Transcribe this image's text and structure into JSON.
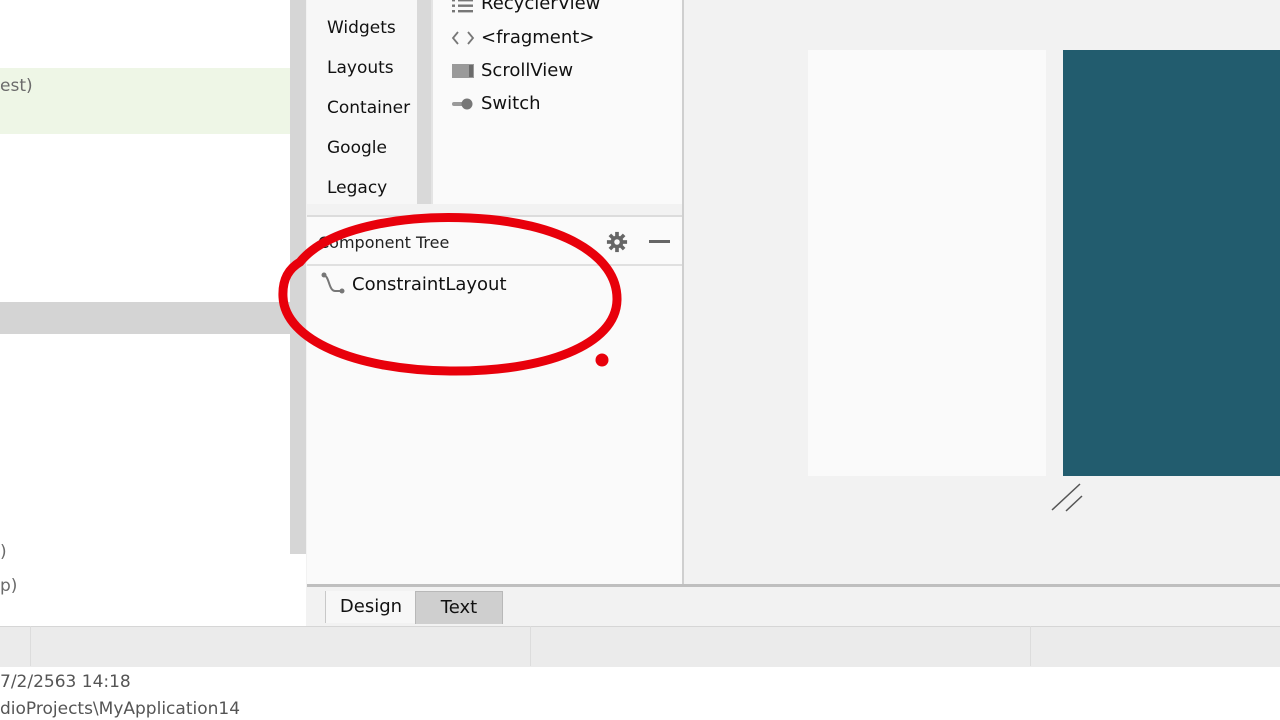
{
  "left_panel": {
    "fragments": [
      "est)",
      ")",
      "p)"
    ]
  },
  "palette": {
    "categories": [
      "Widgets",
      "Layouts",
      "Container",
      "Google",
      "Legacy"
    ],
    "items": [
      {
        "label": "RecyclerView",
        "icon": "list-icon"
      },
      {
        "label": "<fragment>",
        "icon": "code-brackets-icon"
      },
      {
        "label": "ScrollView",
        "icon": "scrollview-icon"
      },
      {
        "label": "Switch",
        "icon": "toggle-icon"
      }
    ]
  },
  "component_tree": {
    "title": "Component Tree",
    "root_item": "ConstraintLayout",
    "root_icon": "constraint-layout-icon",
    "actions": [
      "gear-icon",
      "minimize-icon"
    ]
  },
  "editor_tabs": [
    "Design",
    "Text"
  ],
  "bottom_info": {
    "date": "7/2/2563 14:18",
    "path": "dioProjects\\MyApplication14"
  },
  "colors": {
    "device_screen": "#225c6e",
    "annotation": "#e8000b"
  },
  "annotations": [
    "red-circle-annotation"
  ]
}
